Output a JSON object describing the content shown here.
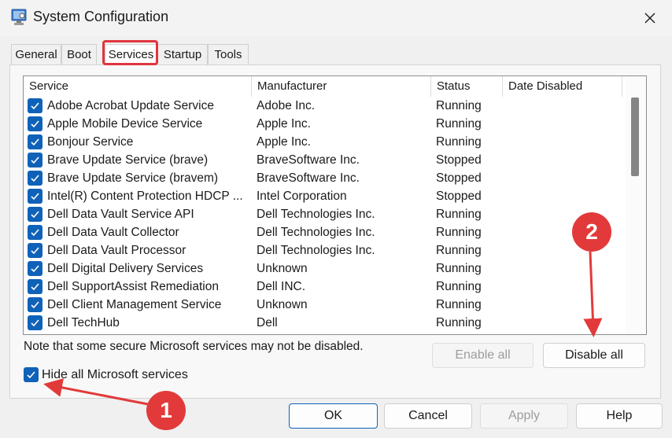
{
  "window": {
    "title": "System Configuration",
    "close_icon": "close-icon"
  },
  "tabs": [
    {
      "label": "General"
    },
    {
      "label": "Boot"
    },
    {
      "label": "Services",
      "active": true
    },
    {
      "label": "Startup"
    },
    {
      "label": "Tools"
    }
  ],
  "columns": [
    "Service",
    "Manufacturer",
    "Status",
    "Date Disabled"
  ],
  "services": [
    {
      "name": "Adobe Acrobat Update Service",
      "manufacturer": "Adobe Inc.",
      "status": "Running",
      "date_disabled": "",
      "checked": true
    },
    {
      "name": "Apple Mobile Device Service",
      "manufacturer": "Apple Inc.",
      "status": "Running",
      "date_disabled": "",
      "checked": true
    },
    {
      "name": "Bonjour Service",
      "manufacturer": "Apple Inc.",
      "status": "Running",
      "date_disabled": "",
      "checked": true
    },
    {
      "name": "Brave Update Service (brave)",
      "manufacturer": "BraveSoftware Inc.",
      "status": "Stopped",
      "date_disabled": "",
      "checked": true
    },
    {
      "name": "Brave Update Service (bravem)",
      "manufacturer": "BraveSoftware Inc.",
      "status": "Stopped",
      "date_disabled": "",
      "checked": true
    },
    {
      "name": "Intel(R) Content Protection HDCP ...",
      "manufacturer": "Intel Corporation",
      "status": "Stopped",
      "date_disabled": "",
      "checked": true
    },
    {
      "name": "Dell Data Vault Service API",
      "manufacturer": "Dell Technologies Inc.",
      "status": "Running",
      "date_disabled": "",
      "checked": true
    },
    {
      "name": "Dell Data Vault Collector",
      "manufacturer": "Dell Technologies Inc.",
      "status": "Running",
      "date_disabled": "",
      "checked": true
    },
    {
      "name": "Dell Data Vault Processor",
      "manufacturer": "Dell Technologies Inc.",
      "status": "Running",
      "date_disabled": "",
      "checked": true
    },
    {
      "name": "Dell Digital Delivery Services",
      "manufacturer": "Unknown",
      "status": "Running",
      "date_disabled": "",
      "checked": true
    },
    {
      "name": "Dell SupportAssist Remediation",
      "manufacturer": "Dell INC.",
      "status": "Running",
      "date_disabled": "",
      "checked": true
    },
    {
      "name": "Dell Client Management Service",
      "manufacturer": "Unknown",
      "status": "Running",
      "date_disabled": "",
      "checked": true
    },
    {
      "name": "Dell TechHub",
      "manufacturer": "Dell",
      "status": "Running",
      "date_disabled": "",
      "checked": true
    }
  ],
  "note": "Note that some secure Microsoft services may not be disabled.",
  "buttons": {
    "enable_all": "Enable all",
    "disable_all": "Disable all",
    "ok": "OK",
    "cancel": "Cancel",
    "apply": "Apply",
    "help": "Help"
  },
  "hide_ms": {
    "label": "Hide all Microsoft services",
    "checked": true
  },
  "annotations": [
    {
      "number": "1",
      "color": "#e23a3a"
    },
    {
      "number": "2",
      "color": "#e23a3a"
    }
  ],
  "colors": {
    "accent": "#0f62b8",
    "highlight": "#e0353d",
    "annotation": "#e23a3a"
  }
}
